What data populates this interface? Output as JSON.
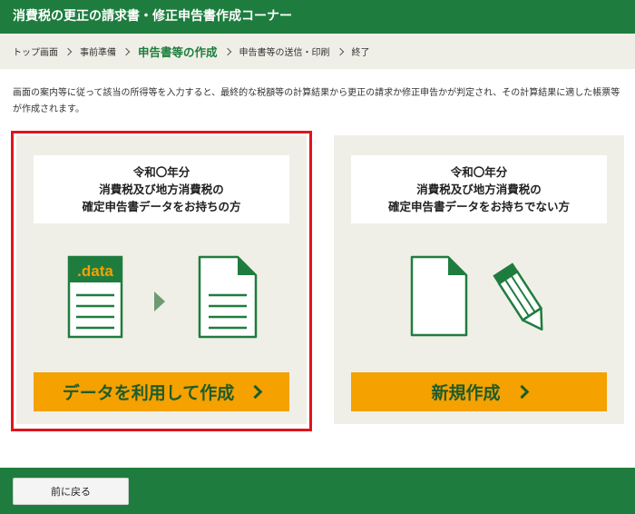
{
  "header": {
    "title": "消費税の更正の請求書・修正申告書作成コーナー"
  },
  "breadcrumb": {
    "items": [
      "トップ画面",
      "事前準備",
      "申告書等の作成",
      "申告書等の送信・印刷",
      "終了"
    ],
    "current_index": 2
  },
  "description": "画面の案内等に従って該当の所得等を入力すると、最終的な税額等の計算結果から更正の請求か修正申告かが判定され、その計算結果に適した帳票等が作成されます。",
  "options": [
    {
      "title_lines": [
        "令和〇年分",
        "消費税及び地方消費税の",
        "確定申告書データをお持ちの方"
      ],
      "file_label": ".data",
      "button_label": "データを利用して作成"
    },
    {
      "title_lines": [
        "令和〇年分",
        "消費税及び地方消費税の",
        "確定申告書データをお持ちでない方"
      ],
      "button_label": "新規作成"
    }
  ],
  "footer": {
    "back_label": "前に戻る"
  },
  "colors": {
    "brand_green": "#1e7d3e",
    "action_orange": "#f5a100",
    "highlight_red": "#e0141e",
    "panel_beige": "#f0efe7"
  }
}
